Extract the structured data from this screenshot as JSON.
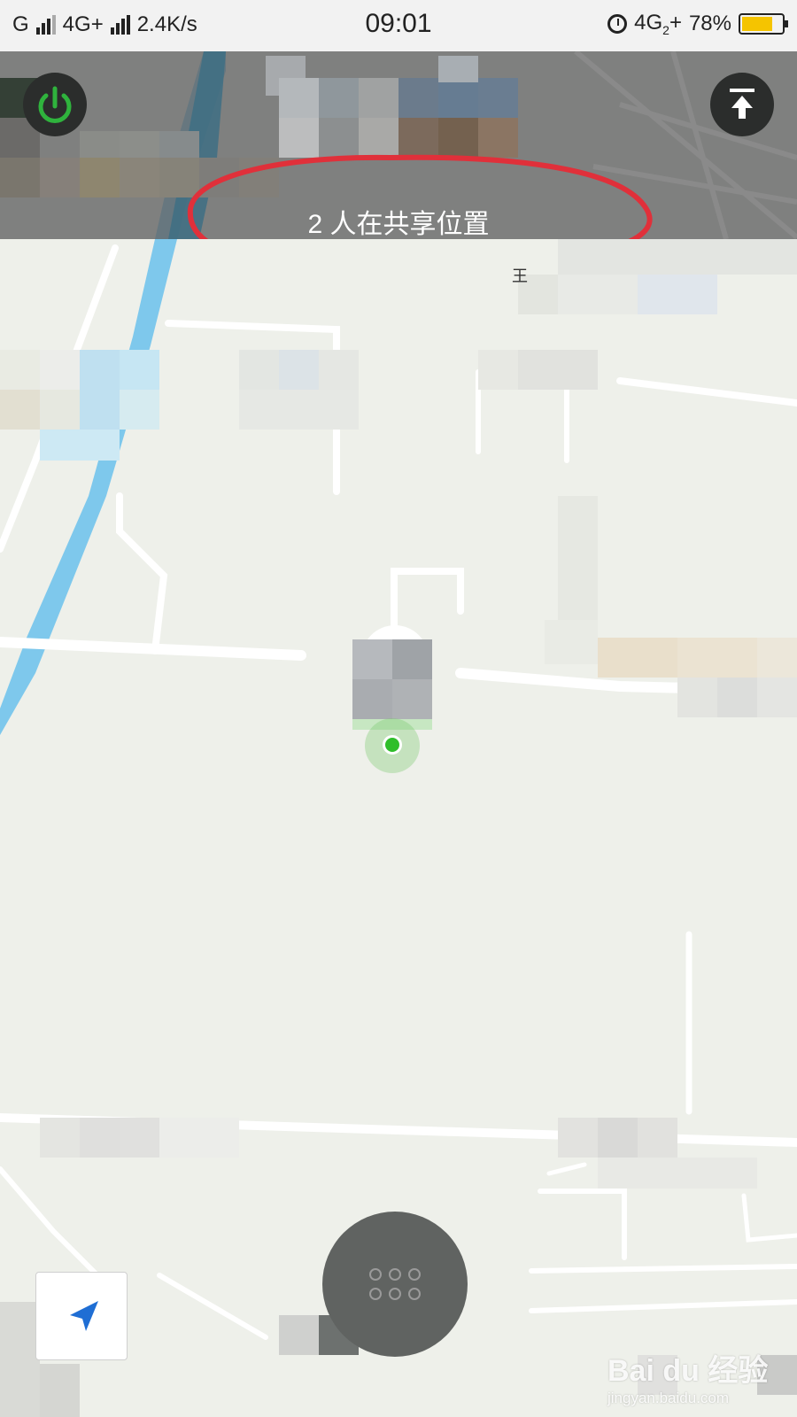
{
  "status_bar": {
    "carrier1": "G",
    "carrier2": "4G+",
    "speed": "2.4K/s",
    "time": "09:01",
    "network_right": "4G",
    "sim_index": "2",
    "network_plus": "+",
    "battery": "78%",
    "battery_level": 0.78,
    "battery_color": "#f5c400"
  },
  "overlay": {
    "share_text": "2 人在共享位置",
    "annotation_color": "#e0303a"
  },
  "map": {
    "poi_fragment": "王",
    "water_color": "#7ec8ec",
    "land_color": "#eef0ea",
    "road_color": "#ffffff"
  },
  "controls": {
    "power_icon": "power-icon",
    "collapse_icon": "collapse-up-icon",
    "locate_icon": "locate-arrow-icon",
    "menu_icon": "grid-dots-icon"
  },
  "watermark": {
    "brand": "Bai du 经验",
    "url": "jingyan.baidu.com"
  }
}
